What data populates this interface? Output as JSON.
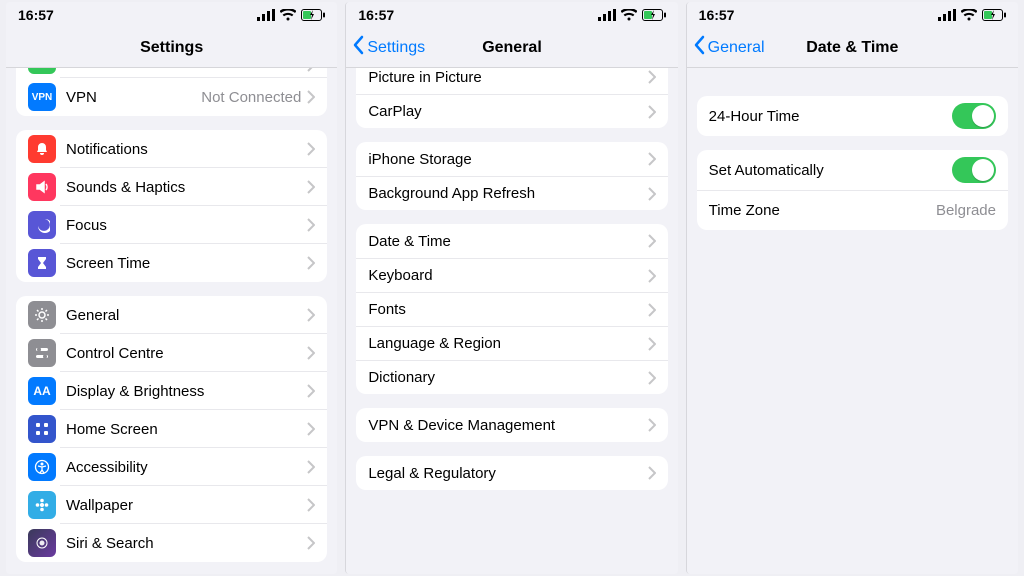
{
  "status": {
    "time": "16:57"
  },
  "colors": {
    "blue": "#027aff",
    "green": "#34c759",
    "red": "#ff3b30",
    "pink": "#ff375f",
    "indigo": "#5856d6",
    "orange": "#ff9500",
    "gray": "#8e8e93",
    "teal": "#32ade6",
    "darkblue": "#0a7aff"
  },
  "pane1": {
    "title": "Settings",
    "topPartialLabel": "…",
    "rows0": [
      {
        "label": "VPN",
        "value": "Not Connected",
        "icon": "vpn",
        "bg": "#027aff"
      }
    ],
    "rows1": [
      {
        "label": "Notifications",
        "icon": "bell",
        "bg": "#ff3b30"
      },
      {
        "label": "Sounds & Haptics",
        "icon": "speaker",
        "bg": "#ff375f"
      },
      {
        "label": "Focus",
        "icon": "moon",
        "bg": "#5856d6"
      },
      {
        "label": "Screen Time",
        "icon": "hourglass",
        "bg": "#5856d6"
      }
    ],
    "rows2": [
      {
        "label": "General",
        "icon": "gear",
        "bg": "#8e8e93"
      },
      {
        "label": "Control Centre",
        "icon": "switches",
        "bg": "#8e8e93"
      },
      {
        "label": "Display & Brightness",
        "icon": "aa",
        "bg": "#027aff"
      },
      {
        "label": "Home Screen",
        "icon": "grid",
        "bg": "#3355cc"
      },
      {
        "label": "Accessibility",
        "icon": "person",
        "bg": "#027aff"
      },
      {
        "label": "Wallpaper",
        "icon": "flower",
        "bg": "#32ade6"
      },
      {
        "label": "Siri & Search",
        "icon": "siri",
        "bg": "#111111"
      }
    ]
  },
  "pane2": {
    "back": "Settings",
    "title": "General",
    "rowsA": [
      {
        "label": "Picture in Picture"
      },
      {
        "label": "CarPlay"
      }
    ],
    "rowsB": [
      {
        "label": "iPhone Storage"
      },
      {
        "label": "Background App Refresh"
      }
    ],
    "rowsC": [
      {
        "label": "Date & Time"
      },
      {
        "label": "Keyboard"
      },
      {
        "label": "Fonts"
      },
      {
        "label": "Language & Region"
      },
      {
        "label": "Dictionary"
      }
    ],
    "rowsD": [
      {
        "label": "VPN & Device Management"
      }
    ],
    "rowsE": [
      {
        "label": "Legal & Regulatory"
      }
    ]
  },
  "pane3": {
    "back": "General",
    "title": "Date & Time",
    "group1": [
      {
        "label": "24-Hour Time",
        "type": "toggle",
        "on": true
      }
    ],
    "group2": [
      {
        "label": "Set Automatically",
        "type": "toggle",
        "on": true
      },
      {
        "label": "Time Zone",
        "type": "value",
        "value": "Belgrade"
      }
    ]
  }
}
